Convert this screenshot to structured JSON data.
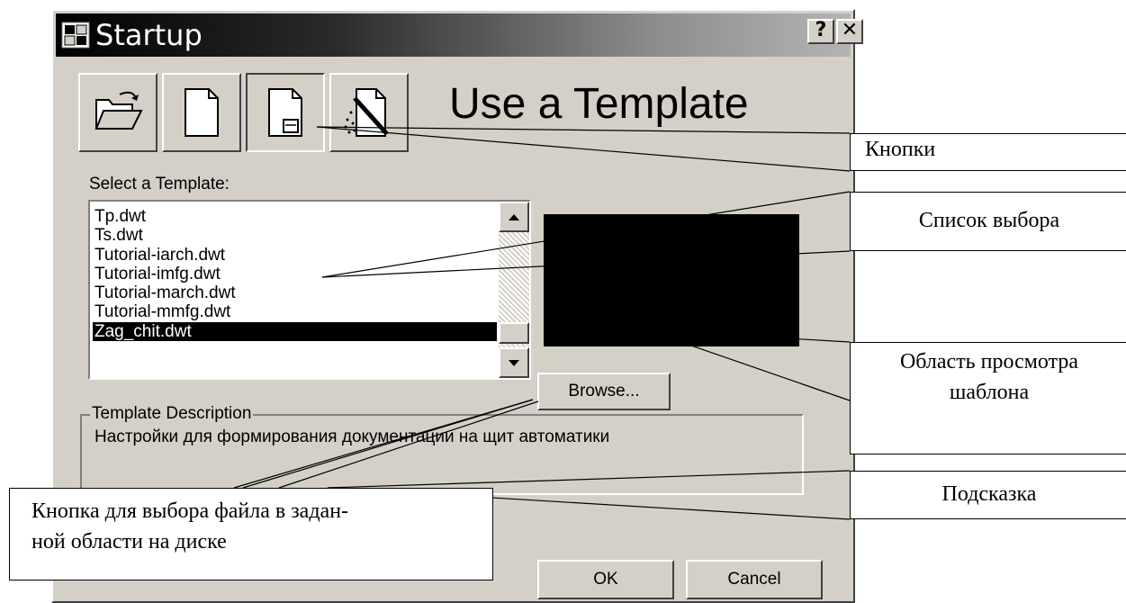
{
  "window": {
    "title": "Startup",
    "help_label": "?",
    "close_label": "✕"
  },
  "toolbar": {
    "buttons": [
      {
        "icon": "open-folder-icon",
        "pressed": false
      },
      {
        "icon": "blank-document-icon",
        "pressed": false
      },
      {
        "icon": "template-document-icon",
        "pressed": true
      },
      {
        "icon": "wizard-document-icon",
        "pressed": false
      }
    ],
    "heading": "Use a Template"
  },
  "template_list": {
    "label": "Select a Template:",
    "items": [
      "Tp.dwt",
      "Ts.dwt",
      "Tutorial-iarch.dwt",
      "Tutorial-imfg.dwt",
      "Tutorial-march.dwt",
      "Tutorial-mmfg.dwt",
      "Zag_chit.dwt"
    ],
    "selected": "Zag_chit.dwt"
  },
  "browse_label": "Browse...",
  "description": {
    "legend": "Template Description",
    "text": "Настройки для формирования документации на щит автоматики"
  },
  "ok_label": "OK",
  "cancel_label": "Cancel",
  "callouts": {
    "buttons": "Кнопки",
    "list": "Список выбора",
    "preview_line1": "Область просмотра",
    "preview_line2": "шаблона",
    "hint": "Подсказка",
    "browse_line1": "Кнопка для выбора файла в задан-",
    "browse_line2": "ной области на диске"
  }
}
